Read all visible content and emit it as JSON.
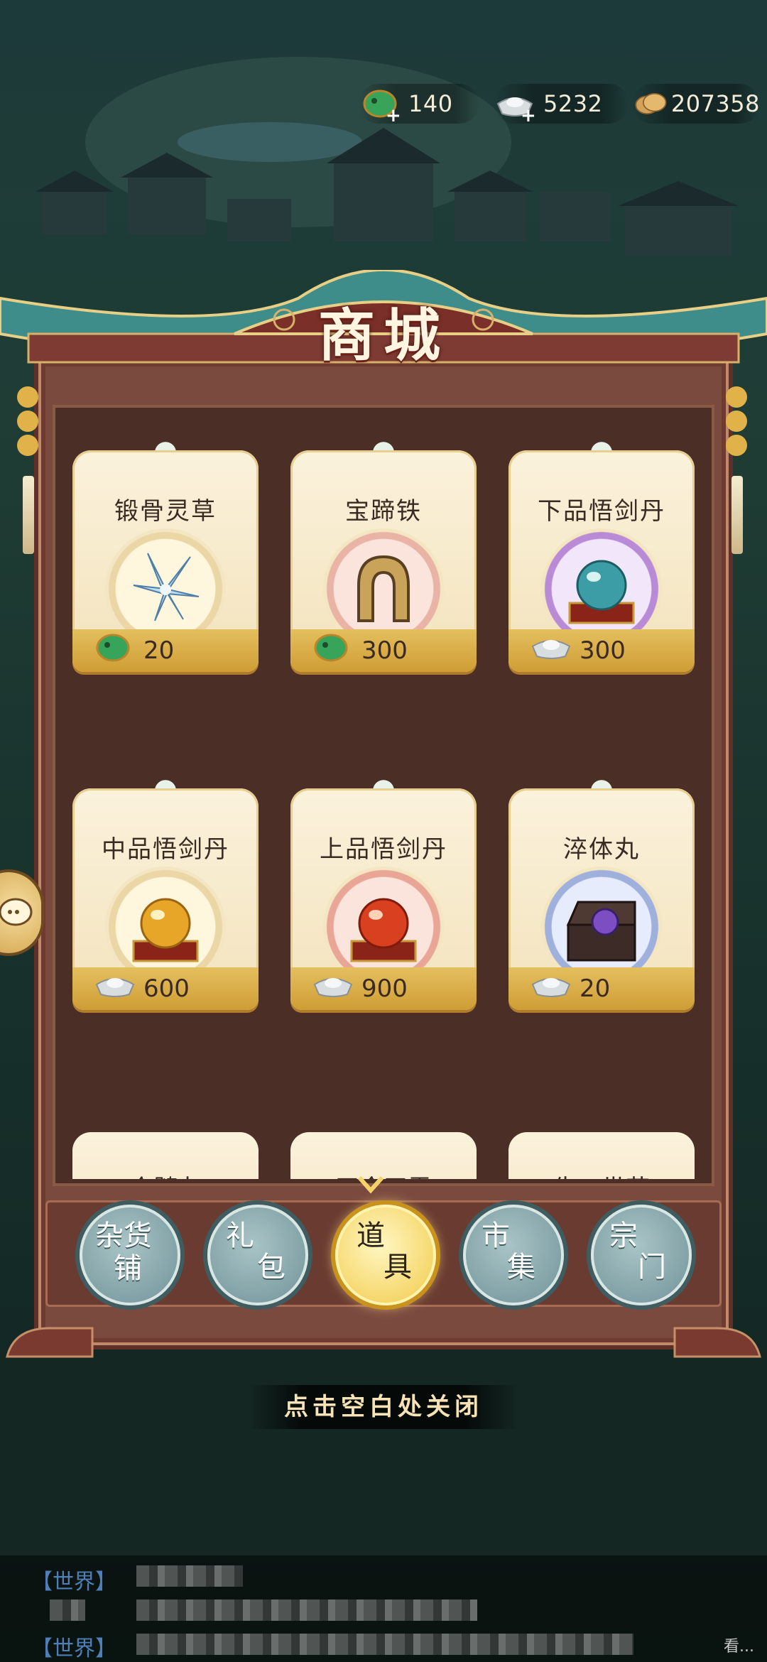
{
  "currency": {
    "jade": "140",
    "silver": "5232",
    "copper": "207358"
  },
  "shop": {
    "title": "商城",
    "items": [
      {
        "name": "锻骨灵草",
        "price": "20",
        "currency_icon": "jade-fish-icon",
        "image": "blue-flower-herb"
      },
      {
        "name": "宝蹄铁",
        "price": "300",
        "currency_icon": "jade-fish-icon",
        "image": "horseshoe"
      },
      {
        "name": "下品悟剑丹",
        "price": "300",
        "currency_icon": "silver-ingot-icon",
        "image": "teal-pill-on-stand"
      },
      {
        "name": "中品悟剑丹",
        "price": "600",
        "currency_icon": "silver-ingot-icon",
        "image": "gold-pill-on-stand"
      },
      {
        "name": "上品悟剑丹",
        "price": "900",
        "currency_icon": "silver-ingot-icon",
        "image": "red-pill-on-stand"
      },
      {
        "name": "淬体丸",
        "price": "20",
        "currency_icon": "silver-ingot-icon",
        "image": "purple-pill-in-chest"
      }
    ],
    "partial_items": [
      "仓髓丸",
      "天今天雷",
      "生一世花"
    ]
  },
  "tabs": [
    {
      "line1": "杂货",
      "line2": "铺",
      "active": false
    },
    {
      "line1": "礼",
      "line2": "包",
      "active": false
    },
    {
      "line1": "道",
      "line2": "具",
      "active": true
    },
    {
      "line1": "市",
      "line2": "集",
      "active": false
    },
    {
      "line1": "宗",
      "line2": "门",
      "active": false
    }
  ],
  "close_hint": "点击空白处关闭",
  "chat": {
    "rows": [
      "【世界】",
      "",
      "【世界】"
    ],
    "corner": "看..."
  },
  "colors": {
    "cabinet": "#7b4a3f",
    "card": "#fbf2dc",
    "price_band": "#d9ab45",
    "active_tab": "#f1c845",
    "inactive_tab": "#87a6ab"
  }
}
